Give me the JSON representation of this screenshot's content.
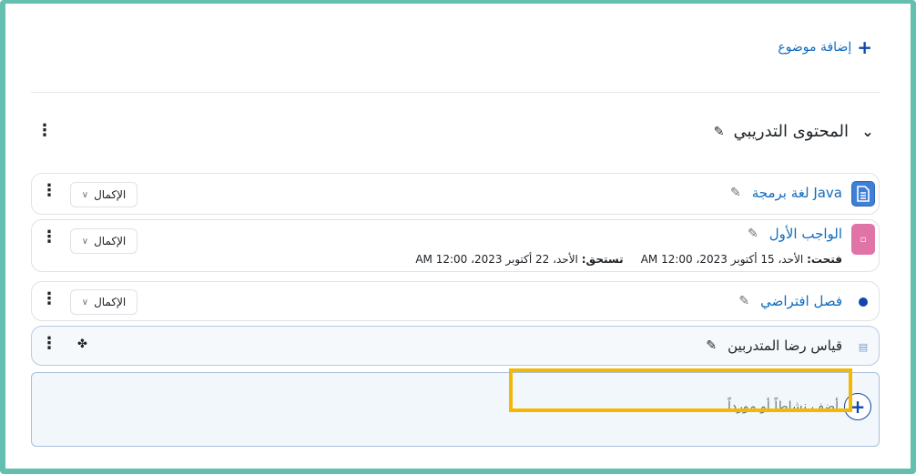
{
  "add_topic": {
    "label": "إضافة موضوع",
    "icon": "plus-icon"
  },
  "section": {
    "title": "المحتوى التدريبي",
    "chevron": "chevron-down-icon"
  },
  "activities": [
    {
      "name": "لغة برمجة Java",
      "type": "file",
      "icon_color": "#3f7fd6",
      "completion": "الإكمال"
    },
    {
      "name": "الواجب الأول",
      "type": "assignment",
      "icon_color": "#e074a7",
      "completion": "الإكمال",
      "opened_label": "فتحت:",
      "opened_value": "الأحد، 15 أكتوبر 2023، 12:00 AM",
      "due_label": "تستحق:",
      "due_value": "الأحد، 22 أكتوبر 2023، 12:00 AM"
    },
    {
      "name": "فصل افتراضي",
      "type": "virtual-class",
      "icon_color": "#0f47ad",
      "completion": "الإكمال"
    },
    {
      "name": "قياس رضا المتدربين",
      "type": "feedback",
      "icon_color": "#7a9bd4"
    }
  ],
  "add_activity": {
    "label": "أضف نشاطاً أو مورداً"
  },
  "colors": {
    "accent": "#0f6cbf",
    "frame": "#64bfae",
    "highlight": "#f4b800"
  }
}
